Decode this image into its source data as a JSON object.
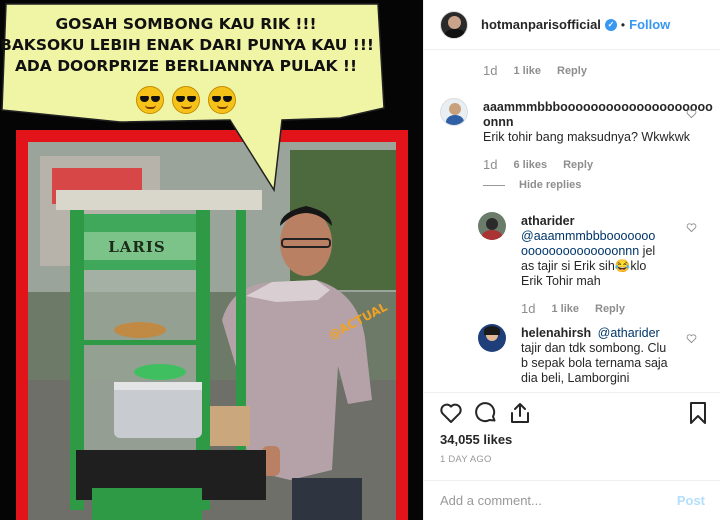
{
  "photo": {
    "bubble_lines": [
      "GOSAH SOMBONG KAU RIK !!!",
      "BAKSOKU LEBIH ENAK DARI PUNYA KAU !!!",
      "ADA DOORPRIZE BERLIANNYA PULAK !!"
    ],
    "emoji_count": 3,
    "emoji_name": "sunglasses-emoji",
    "cart_sign": "LARIS",
    "stamp": "@ACTUAL",
    "frame_color": "#e3131a",
    "bubble_color": "#f0f5a6"
  },
  "header": {
    "username": "hotmanparisofficial",
    "separator": "•",
    "follow_label": "Follow"
  },
  "comments": {
    "top_meta": {
      "age": "1d",
      "likes": "1 like",
      "reply": "Reply"
    },
    "comment1": {
      "user": "aaammmbbbooooooooooooooooooooonnn",
      "text": "Erik tohir bang maksudnya? Wkwkwk",
      "age": "1d",
      "likes": "6 likes",
      "reply": "Reply"
    },
    "hide_replies": "Hide replies",
    "reply1": {
      "user": "atharider",
      "mention": "@aaammmbbbooooooooooooooooooooonnn",
      "text_a": "jelas tajir si Erik sih",
      "emoji": "😂",
      "text_b": "klo Erik Tohir mah",
      "age": "1d",
      "likes": "1 like",
      "reply": "Reply"
    },
    "reply2": {
      "user": "helenahirsh",
      "mention": "@atharider",
      "text": "tajir dan tdk sombong. Club sepak bola ternama saja dia beli, Lamborgini"
    }
  },
  "actions": {
    "likes": "34,055 likes",
    "date": "1 DAY AGO"
  },
  "add_comment": {
    "placeholder": "Add a comment...",
    "post_label": "Post"
  },
  "colors": {
    "link_blue": "#3897f0",
    "post_disabled": "#b2dffc",
    "muted": "#8e8e8e"
  }
}
